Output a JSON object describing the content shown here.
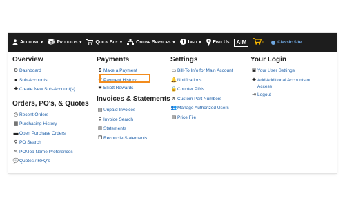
{
  "navbar": {
    "account": "Account",
    "products": "Products",
    "quick_buy": "Quick Buy",
    "online_services": "Online Services",
    "info": "Info",
    "find_us": "Find Us",
    "aim": "AIM",
    "cart_count": "0",
    "classic_site": "Classic Site"
  },
  "overview": {
    "title": "Overview",
    "items": [
      "Dashboard",
      "Sub-Accounts",
      "Create New Sub-Account(s)"
    ]
  },
  "orders": {
    "title": "Orders, PO's, & Quotes",
    "items": [
      "Recent Orders",
      "Purchasing History",
      "Open Purchase Orders",
      "PO Search",
      "PO/Job Name Preferences",
      "Quotes / RFQ's"
    ]
  },
  "payments": {
    "title": "Payments",
    "items": [
      "Make a Payment",
      "Payment History",
      "Elliott Rewards"
    ]
  },
  "invoices": {
    "title": "Invoices & Statements",
    "items": [
      "Unpaid Invoices",
      "Invoice Search",
      "Statements",
      "Reconcile Statements"
    ]
  },
  "settings": {
    "title": "Settings",
    "items": [
      "Bill-To Info for Main Account",
      "Notifications",
      "Counter PINs",
      "Custom Part Numbers",
      "Manage Authorized Users",
      "Price File"
    ]
  },
  "login": {
    "title": "Your Login",
    "items": [
      "Your User Settings",
      "Add Additional Accounts or Access",
      "Logout"
    ]
  },
  "colors": {
    "navbar": "#1d1d1d",
    "link": "#1d5fa8",
    "highlight": "#f28c1e",
    "cart": "#f4b400"
  }
}
